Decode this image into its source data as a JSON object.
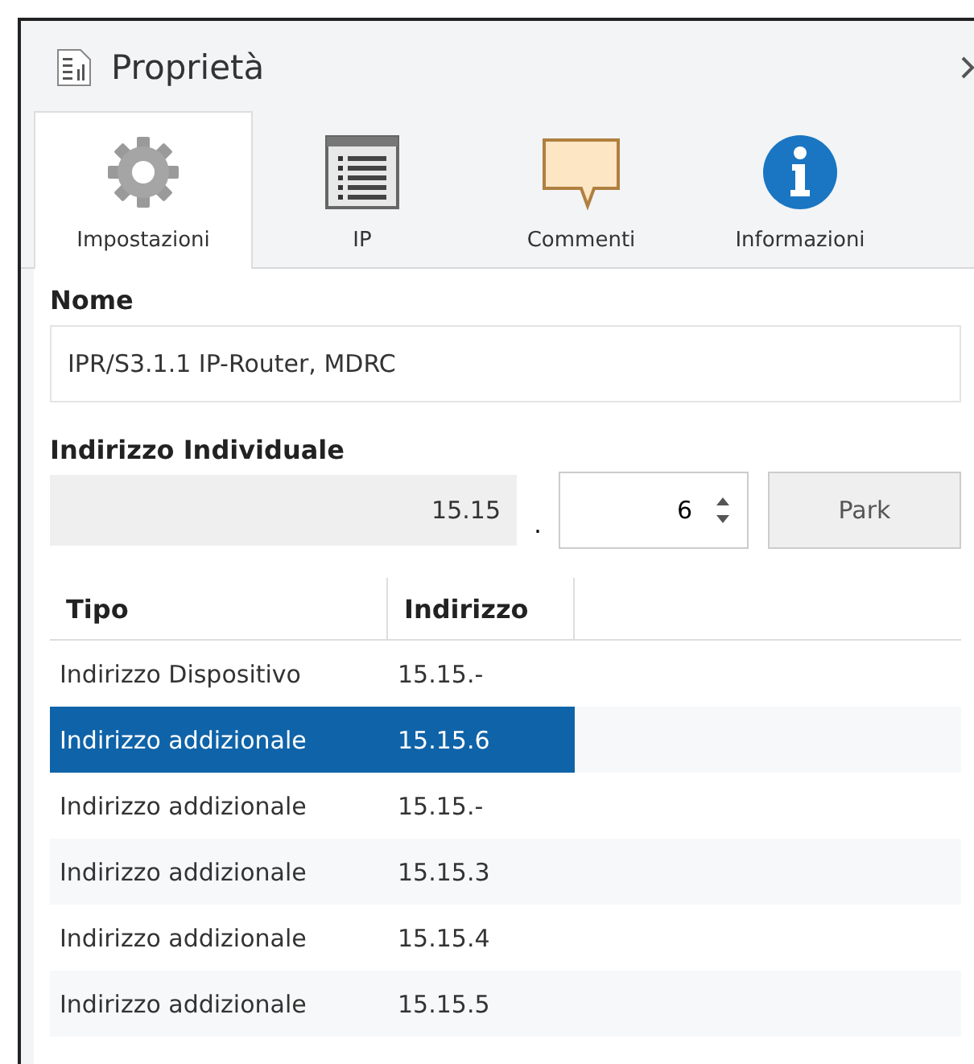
{
  "panel": {
    "title": "Proprietà"
  },
  "tabs": [
    {
      "label": "Impostazioni",
      "kind": "gear",
      "selected": true
    },
    {
      "label": "IP",
      "kind": "list",
      "selected": false
    },
    {
      "label": "Commenti",
      "kind": "comment",
      "selected": false
    },
    {
      "label": "Informazioni",
      "kind": "info",
      "selected": false
    }
  ],
  "name_field": {
    "label": "Nome",
    "value": "IPR/S3.1.1 IP-Router, MDRC"
  },
  "address": {
    "label": "Indirizzo Individuale",
    "prefix": "15.15",
    "separator": ".",
    "device": "6",
    "park_button": "Park"
  },
  "table": {
    "columns": [
      "Tipo",
      "Indirizzo"
    ],
    "rows": [
      {
        "type": "Indirizzo Dispositivo",
        "address": "15.15.-",
        "selected": false
      },
      {
        "type": "Indirizzo addizionale",
        "address": "15.15.6",
        "selected": true
      },
      {
        "type": "Indirizzo addizionale",
        "address": "15.15.-",
        "selected": false
      },
      {
        "type": "Indirizzo addizionale",
        "address": "15.15.3",
        "selected": false
      },
      {
        "type": "Indirizzo addizionale",
        "address": "15.15.4",
        "selected": false
      },
      {
        "type": "Indirizzo addizionale",
        "address": "15.15.5",
        "selected": false
      }
    ]
  }
}
